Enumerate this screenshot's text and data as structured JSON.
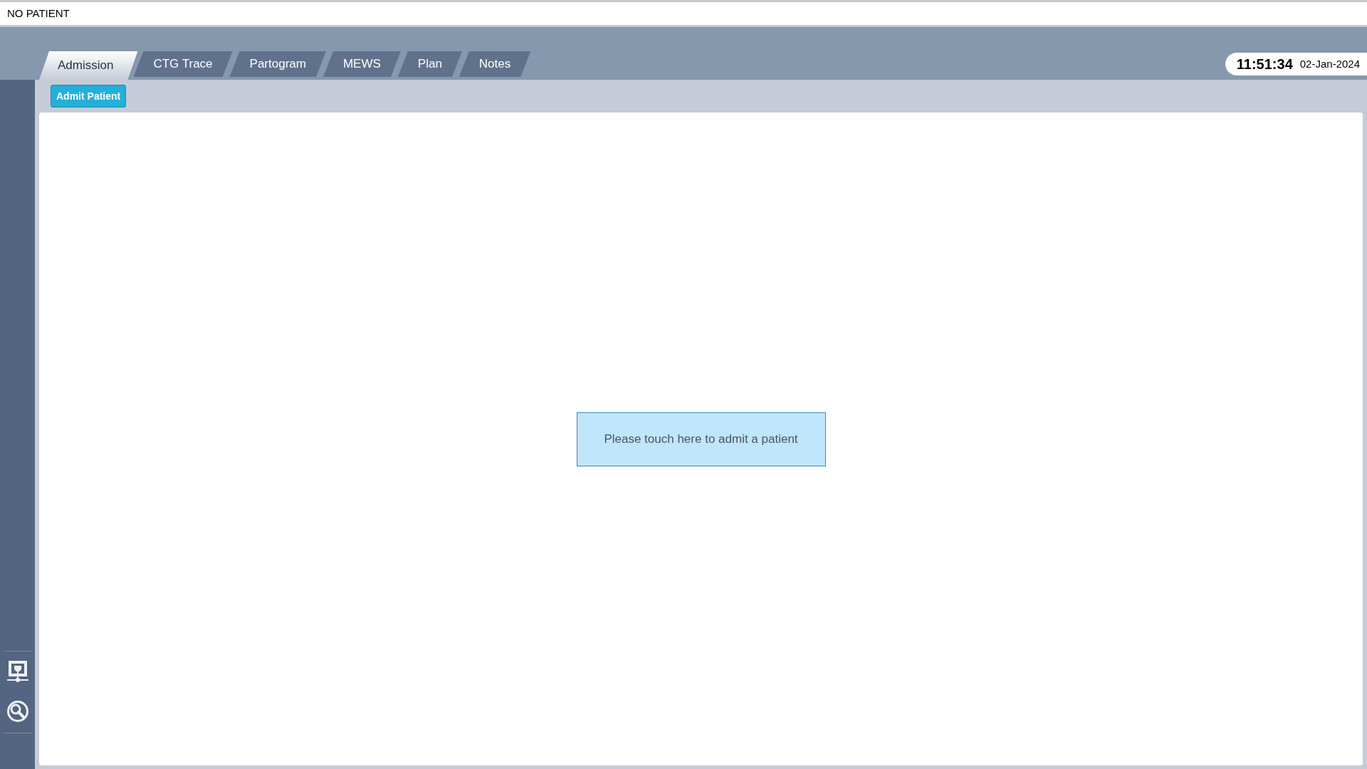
{
  "header": {
    "patient": "NO PATIENT"
  },
  "tabs": [
    {
      "label": "Admission",
      "selected": true
    },
    {
      "label": "CTG Trace",
      "selected": false
    },
    {
      "label": "Partogram",
      "selected": false
    },
    {
      "label": "MEWS",
      "selected": false
    },
    {
      "label": "Plan",
      "selected": false
    },
    {
      "label": "Notes",
      "selected": false
    }
  ],
  "clock": {
    "time": "11:51:34",
    "date": "02-Jan-2024"
  },
  "toolbar": {
    "button": "Admit Patient"
  },
  "content": {
    "prompt": "Please touch here to admit a patient"
  }
}
